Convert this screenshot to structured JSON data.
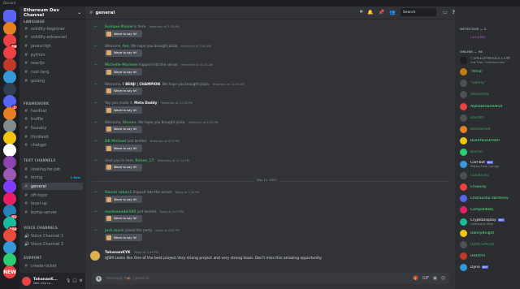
{
  "window": {
    "title": "Discord"
  },
  "colors": {
    "accent": "#5865f2",
    "online": "#23a55a",
    "mention": "#f23f43",
    "member_green": "#3ba55d"
  },
  "rail": {
    "servers": [
      {
        "name": "direct-messages",
        "initial": "",
        "color": "#5865f2",
        "badge": ""
      },
      {
        "name": "server-1",
        "initial": "",
        "color": "#e67e22",
        "badge": ""
      },
      {
        "name": "server-2",
        "initial": "",
        "color": "#ed4245",
        "badge": "19"
      },
      {
        "name": "server-3",
        "initial": "",
        "color": "#ed4245",
        "badge": ""
      },
      {
        "name": "server-4",
        "initial": "",
        "color": "#c0392b",
        "badge": ""
      },
      {
        "name": "server-5",
        "initial": "",
        "color": "#3498db",
        "badge": ""
      },
      {
        "name": "server-6",
        "initial": "",
        "color": "#2c3e50",
        "badge": ""
      },
      {
        "name": "server-7",
        "initial": "",
        "color": "#5865f2",
        "badge": "2"
      },
      {
        "name": "server-8",
        "initial": "",
        "color": "#e67e22",
        "badge": ""
      },
      {
        "name": "server-9",
        "initial": "",
        "color": "#7f8c8d",
        "badge": ""
      },
      {
        "name": "server-10",
        "initial": "",
        "color": "#f1c40f",
        "badge": ""
      },
      {
        "name": "server-11",
        "initial": "",
        "color": "#ffffff",
        "badge": ""
      },
      {
        "name": "server-12",
        "initial": "",
        "color": "#8e44ad",
        "badge": ""
      },
      {
        "name": "server-13",
        "initial": "",
        "color": "#9b59b6",
        "badge": ""
      },
      {
        "name": "server-14",
        "initial": "",
        "color": "#7d3cff",
        "badge": ""
      },
      {
        "name": "server-15",
        "initial": "",
        "color": "#e91e63",
        "badge": ""
      },
      {
        "name": "server-16",
        "initial": "",
        "color": "#2980b9",
        "badge": "41"
      },
      {
        "name": "server-17",
        "initial": "",
        "color": "#1abc9c",
        "badge": "184"
      },
      {
        "name": "server-18",
        "initial": "",
        "color": "#e74c3c",
        "badge": ""
      },
      {
        "name": "server-19",
        "initial": "",
        "color": "#3498db",
        "badge": ""
      },
      {
        "name": "server-20",
        "initial": "",
        "color": "#2ecc71",
        "badge": ""
      },
      {
        "name": "server-21",
        "initial": "NEW",
        "color": "#ed4245",
        "badge": ""
      }
    ]
  },
  "sidebar": {
    "server_name": "Ethereum Dev Channel",
    "categories": [
      {
        "name": "LANGUAGE",
        "channels": [
          "solidity-beginner",
          "solidity-advanced",
          "javascript",
          "python",
          "reactjs",
          "rust-lang",
          "golang"
        ]
      },
      {
        "name": "FRAMEWORK",
        "channels": [
          "hardhat",
          "truffle",
          "foundry",
          "thirdweb",
          "chatgpt"
        ]
      },
      {
        "name": "TEXT CHANNELS",
        "channels": [
          "looking-for-job",
          "hiring",
          "general",
          "off-topic",
          "level-up",
          "bump-server"
        ]
      },
      {
        "name": "VOICE CHANNELS",
        "channels": [
          "Voice Channel 1",
          "Voice Channel 2"
        ]
      },
      {
        "name": "SUPPORT",
        "channels": [
          "create-ticket"
        ]
      }
    ],
    "new_label": "1 New",
    "user": {
      "name": "TahananK...",
      "status": "Wait who ca..."
    }
  },
  "chat": {
    "channel_name": "general",
    "search_placeholder": "Search",
    "wave_label": "Wave to say hi!",
    "join_messages": [
      {
        "pre": "",
        "user": "Enrique Daniel",
        "post": " is here.",
        "time": "Yesterday at 3:28 AM",
        "color": "#3ba55d"
      },
      {
        "pre": "Welcome, ",
        "user": "fen",
        "post": ". We hope you brought pizza.",
        "time": "Yesterday at 3:44 AM",
        "color": "#3ba55d"
      },
      {
        "pre": "",
        "user": "Michelle-Marlene",
        "post": " hopped into the server.",
        "time": "Yesterday at 10:24 AM",
        "color": "#3ba55d"
      },
      {
        "pre": "Welcome, ",
        "user": "! BENJI | CHAMPION",
        "post": ". We hope you brought pizza.",
        "time": "Yesterday at 11:49 AM",
        "color": "#f2f3f5"
      },
      {
        "pre": "Yay you made it, ",
        "user": "Meta Daddy",
        "post": "!",
        "time": "Yesterday at 12:54 PM",
        "color": "#f2f3f5"
      },
      {
        "pre": "Welcome, ",
        "user": "Steven.",
        "post": " We hope you brought pizza.",
        "time": "Yesterday at 5:30 PM",
        "color": "#3ba55d"
      },
      {
        "pre": "",
        "user": "DR Michael",
        "post": " just landed.",
        "time": "Yesterday at 9:03 PM",
        "color": "#3ba55d"
      },
      {
        "pre": "Glad you're here, ",
        "user": "Rohan_17",
        "post": ".",
        "time": "Yesterday at 11:14 PM",
        "color": "#3ba55d"
      }
    ],
    "date_divider": "May 11, 2023",
    "join_messages_2": [
      {
        "pre": "",
        "user": "Daniel ruben1",
        "post": " hopped into the server.",
        "time": "Today at 1:34 PM",
        "color": "#3ba55d"
      },
      {
        "pre": "",
        "user": "markmendal100",
        "post": " just landed.",
        "time": "Today at 3:03 PM",
        "color": "#3ba55d"
      },
      {
        "pre": "",
        "user": "jack mack",
        "post": " joined the party.",
        "time": "Today at 3:20 PM",
        "color": "#3ba55d"
      }
    ],
    "author_message": {
      "author": "TahananKYK",
      "time": "Today at 3:46 PM",
      "text": "$JSM Looks like One of the best project.Very strong project and very strong team. Don't miss this amazing opportunity."
    },
    "composer_placeholder": "Message #🐗 | general"
  },
  "members": {
    "groups": [
      {
        "title": "DETECTIVE — 1",
        "members": [
          {
            "name": "LEGEND",
            "sub": "",
            "color": "#9b59b6",
            "avatar": "#2c2f33"
          }
        ]
      },
      {
        "title": "ONLINE — 96",
        "members": [
          {
            "name": "! SPEEDYNODES.COM",
            "sub": "Free Trails \"unlimited calls\"",
            "color": "#949ba4",
            "avatar": "#1e1f22"
          },
          {
            "name": "\"Anna\"",
            "sub": "",
            "color": "#57f287",
            "avatar": "#c27c0e"
          },
          {
            "name": "\"Danny\"",
            "sub": "",
            "color": "#3ba55d",
            "avatar": "#4e5058"
          },
          {
            "name": "Aeonchria",
            "sub": "",
            "color": "#3ba55d",
            "avatar": "#4e5058"
          },
          {
            "name": "AlphaDream0914",
            "sub": "",
            "color": "#57f287",
            "avatar": "#ed4245"
          },
          {
            "name": "Barroth",
            "sub": "",
            "color": "#3ba55d",
            "avatar": "#4e5058"
          },
          {
            "name": "Benhamelt",
            "sub": "",
            "color": "#3ba55d",
            "avatar": "#e67e22"
          },
          {
            "name": "BuildYourDream",
            "sub": "",
            "color": "#57f287",
            "avatar": "#f1c40f"
          },
          {
            "name": "Burner",
            "sub": "",
            "color": "#3ba55d",
            "avatar": "#2ecc71"
          },
          {
            "name": "Carl-bot",
            "sub": "Playing /help | carl.gg",
            "color": "#f2f3f5",
            "avatar": "#3498db",
            "bot": "BOT"
          },
          {
            "name": "CDGKGnu",
            "sub": "",
            "color": "#3ba55d",
            "avatar": "#4e5058"
          },
          {
            "name": "Chancey",
            "sub": "",
            "color": "#57f287",
            "avatar": "#ed4245"
          },
          {
            "name": "Chitransha Varshney",
            "sub": "",
            "color": "#57f287",
            "avatar": "#5865f2"
          },
          {
            "name": "CompatibleC",
            "sub": "",
            "color": "#57f287",
            "avatar": "#e91e63"
          },
          {
            "name": "CryptoDisplay",
            "sub": "Listening to /help",
            "color": "#f2f3f5",
            "avatar": "#1abc9c",
            "bot": "BOT"
          },
          {
            "name": "DannyKnight",
            "sub": "",
            "color": "#57f287",
            "avatar": "#f1c40f"
          },
          {
            "name": "Delta Official",
            "sub": "",
            "color": "#3ba55d",
            "avatar": "#4e5058"
          },
          {
            "name": "Dextrrrs",
            "sub": "",
            "color": "#57f287",
            "avatar": "#c0392b"
          },
          {
            "name": "Dyno",
            "sub": "",
            "color": "#f2f3f5",
            "avatar": "#3498db",
            "bot": "BOT"
          }
        ]
      }
    ]
  }
}
